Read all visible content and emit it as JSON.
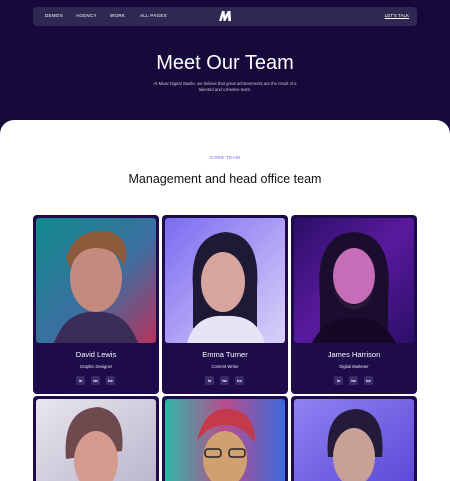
{
  "nav": {
    "links": [
      "DEMOS",
      "AGENCY",
      "WORK",
      "ALL PAGES"
    ],
    "cta": "LET'S TALK"
  },
  "hero": {
    "title": "Meet Our Team",
    "subtitle": "At Mixar Digital Studio, we believe that great achievements are the result of a talented and cohesive team."
  },
  "section": {
    "eyebrow": "CORE TEAM",
    "title": "Management and head office team"
  },
  "team": [
    {
      "name": "David Lewis",
      "role": "Graphic Designer",
      "socials": [
        "in",
        "tw",
        "be"
      ]
    },
    {
      "name": "Emma Turner",
      "role": "Content Writer",
      "socials": [
        "in",
        "tw",
        "be"
      ]
    },
    {
      "name": "James Harrison",
      "role": "Digital Marketer",
      "socials": [
        "in",
        "tw",
        "be"
      ]
    }
  ],
  "colors": {
    "hero_bg": "#150a3a",
    "nav_bg": "#2e2952",
    "card_bg": "#1e0b4a",
    "accent": "#6c5ce7"
  },
  "icons": {
    "logo": "m-logo-icon",
    "social": [
      "linkedin-icon",
      "twitter-icon",
      "behance-icon"
    ]
  }
}
